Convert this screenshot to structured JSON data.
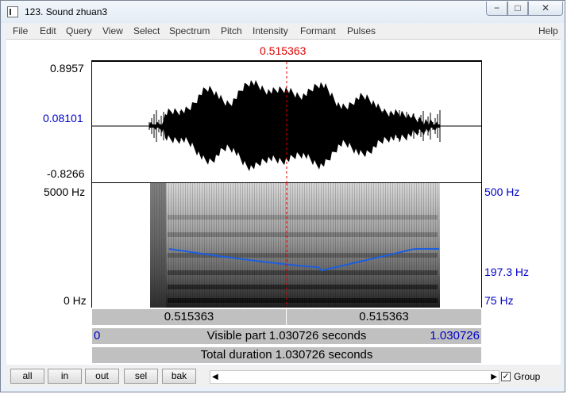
{
  "window": {
    "title": "123. Sound zhuan3",
    "controls": {
      "minimize": "−",
      "maximize": "□",
      "close": "✕"
    }
  },
  "menu": {
    "items": [
      "File",
      "Edit",
      "Query",
      "View",
      "Select",
      "Spectrum",
      "Pitch",
      "Intensity",
      "Formant",
      "Pulses"
    ],
    "help": "Help"
  },
  "cursor": {
    "time_label": "0.515363",
    "time_seconds": 0.515363
  },
  "waveform": {
    "ymax_label": "0.8957",
    "cursor_value_label": "0.08101",
    "ymin_label": "-0.8266"
  },
  "spectrogram": {
    "fmax_label": "5000 Hz",
    "fmin_label": "0 Hz",
    "pitch_max_label": "500 Hz",
    "pitch_cursor_label": "197.3 Hz",
    "pitch_min_label": "75 Hz"
  },
  "bars": {
    "left_segment": "0.515363",
    "right_segment": "0.515363",
    "visible_start": "0",
    "visible_part": "Visible part 1.030726 seconds",
    "visible_end": "1.030726",
    "total_duration": "Total duration 1.030726 seconds"
  },
  "toolbar": {
    "buttons": [
      "all",
      "in",
      "out",
      "sel",
      "bak"
    ],
    "group_label": "Group",
    "group_checked": true
  },
  "colors": {
    "cursor": "#e00000",
    "pitch_axis": "#0000c8",
    "pitch_track": "#1b5ee0"
  }
}
